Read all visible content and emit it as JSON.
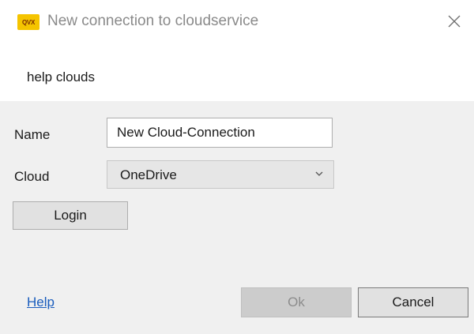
{
  "window": {
    "title": "New connection to cloudservice",
    "app_icon_text": "QVX",
    "icon": "app-logo-icon",
    "close_icon": "close-icon"
  },
  "header": {
    "text": "help clouds"
  },
  "form": {
    "name_label": "Name",
    "name_value": "New Cloud-Connection",
    "cloud_label": "Cloud",
    "cloud_value": "OneDrive",
    "dropdown_icon": "chevron-down-icon"
  },
  "buttons": {
    "login": "Login",
    "ok": "Ok",
    "cancel": "Cancel"
  },
  "footer": {
    "help_link": "Help"
  },
  "colors": {
    "body_background": "#f0f0f0",
    "link": "#1a5dbd",
    "app_icon": "#f5c400",
    "disabled_text": "#8c8c8c"
  }
}
